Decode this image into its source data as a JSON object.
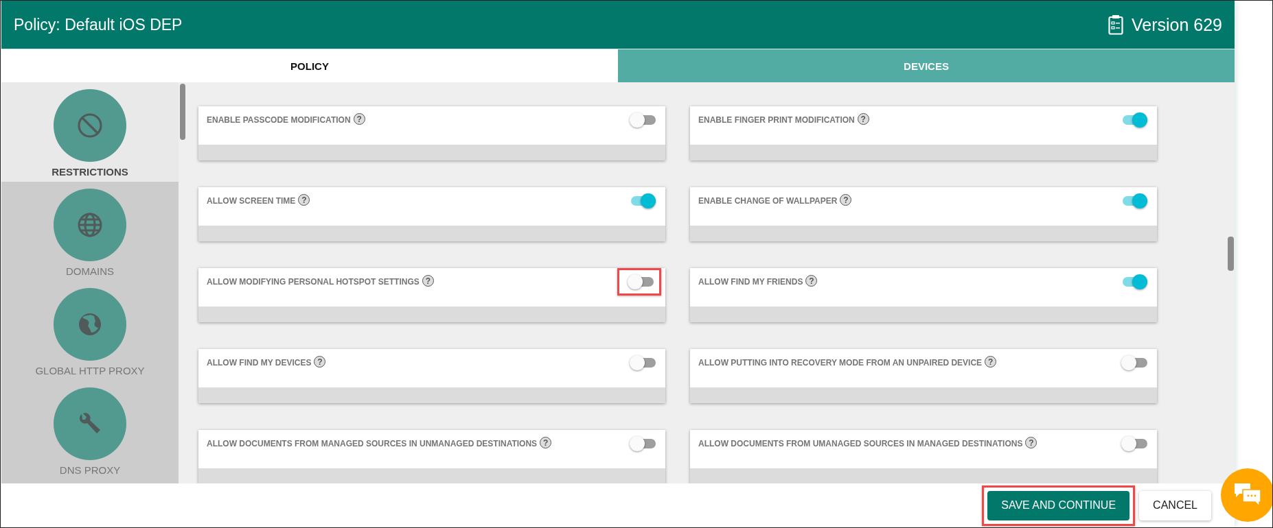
{
  "header": {
    "title": "Policy: Default iOS DEP",
    "version": "Version 629"
  },
  "tabs": [
    {
      "label": "POLICY",
      "selected": true
    },
    {
      "label": "DEVICES",
      "selected": false
    }
  ],
  "sidebar": {
    "items": [
      {
        "label": "RESTRICTIONS",
        "kind": "block",
        "selected": true
      },
      {
        "label": "DOMAINS",
        "kind": "globe",
        "selected": false
      },
      {
        "label": "GLOBAL HTTP PROXY",
        "kind": "earth",
        "selected": false
      },
      {
        "label": "DNS PROXY",
        "kind": "wrench",
        "selected": false
      }
    ]
  },
  "settings": [
    {
      "label": "ENABLE PASSCODE MODIFICATION",
      "help": "?",
      "on": false,
      "highlighted": false
    },
    {
      "label": "ENABLE FINGER PRINT MODIFICATION",
      "help": "?",
      "on": true,
      "highlighted": false
    },
    {
      "label": "ALLOW SCREEN TIME",
      "help": "?",
      "on": true,
      "highlighted": false
    },
    {
      "label": "ENABLE CHANGE OF WALLPAPER",
      "help": "?",
      "on": true,
      "highlighted": false
    },
    {
      "label": "ALLOW MODIFYING PERSONAL HOTSPOT SETTINGS",
      "help": "?",
      "on": false,
      "highlighted": true
    },
    {
      "label": "ALLOW FIND MY FRIENDS",
      "help": "?",
      "on": true,
      "highlighted": false
    },
    {
      "label": "ALLOW FIND MY DEVICES",
      "help": "?",
      "on": false,
      "highlighted": false
    },
    {
      "label": "ALLOW PUTTING INTO RECOVERY MODE FROM AN UNPAIRED DEVICE",
      "help": "?",
      "on": false,
      "highlighted": false
    },
    {
      "label": "ALLOW DOCUMENTS FROM MANAGED SOURCES IN UNMANAGED DESTINATIONS",
      "help": "?",
      "on": false,
      "highlighted": false
    },
    {
      "label": "ALLOW DOCUMENTS FROM UMANAGED SOURCES IN MANAGED DESTINATIONS",
      "help": "?",
      "on": false,
      "highlighted": false
    }
  ],
  "buttons": [
    {
      "label": "SAVE AND CONTINUE",
      "kind": "primary",
      "highlighted": true
    },
    {
      "label": "CANCEL",
      "kind": "secondary",
      "highlighted": false
    }
  ]
}
